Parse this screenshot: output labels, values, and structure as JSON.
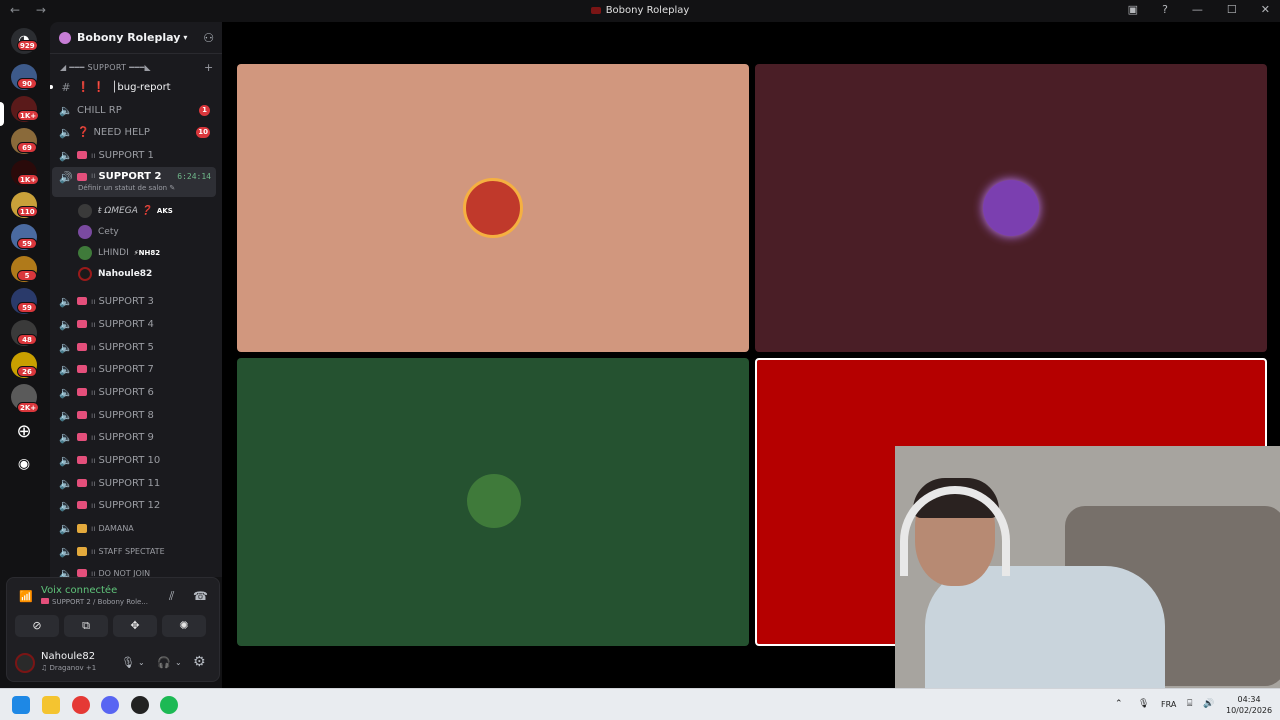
{
  "window": {
    "title": "Bobony Roleplay",
    "nav": "← →",
    "help": "?",
    "minimize": "—",
    "maximize": "☐",
    "close": "✕"
  },
  "servers": {
    "badges": [
      "929",
      "90",
      "1K+",
      "69",
      "1K+",
      "110",
      "59",
      "5",
      "59",
      "48",
      "26",
      "2K+"
    ]
  },
  "sidebar": {
    "server_name": "Bobony Roleplay",
    "category": "◢ ━━━ SUPPORT ━━━◣",
    "channels": [
      {
        "name": "│bug-report",
        "prefix": "❗ ❗",
        "icon": "#",
        "unread": true
      },
      {
        "name": "CHILL RP",
        "count": "1"
      },
      {
        "name": "NEED HELP",
        "prefix": "❓",
        "count": "10"
      },
      {
        "name": "SUPPORT 1"
      },
      {
        "name": "SUPPORT 2",
        "time": "6:24:14",
        "status": "Définir un statut de salon ✎"
      },
      {
        "name": "SUPPORT 3"
      },
      {
        "name": "SUPPORT 4"
      },
      {
        "name": "SUPPORT 5"
      },
      {
        "name": "SUPPORT 7"
      },
      {
        "name": "SUPPORT 6"
      },
      {
        "name": "SUPPORT 8"
      },
      {
        "name": "SUPPORT 9"
      },
      {
        "name": "SUPPORT 10"
      },
      {
        "name": "SUPPORT 11"
      },
      {
        "name": "SUPPORT 12"
      },
      {
        "name": "DAMANA"
      },
      {
        "name": "STAFF SPECTATE"
      },
      {
        "name": "DO NOT JOIN"
      }
    ],
    "voice_users": [
      {
        "name": "ŧ ΩMEGA ❓",
        "tag": "AKS"
      },
      {
        "name": "Cety",
        "tag": ""
      },
      {
        "name": "LHINDI",
        "tag": "⚡NH82"
      },
      {
        "name": "Nahoule82",
        "tag": ""
      }
    ]
  },
  "voice_panel": {
    "status": "Voix connectée",
    "channel": "SUPPORT 2 / Bobony Role...",
    "user_name": "Nahoule82",
    "user_sub": "♫ Draganov +1"
  },
  "stage": {
    "tile_colors": [
      "#d1977e",
      "#4a1e26",
      "#255230",
      "#b50000"
    ]
  },
  "taskbar": {
    "lang": "FRA",
    "time": "04:34",
    "date": "10/02/2026",
    "chevron": "⌃"
  }
}
